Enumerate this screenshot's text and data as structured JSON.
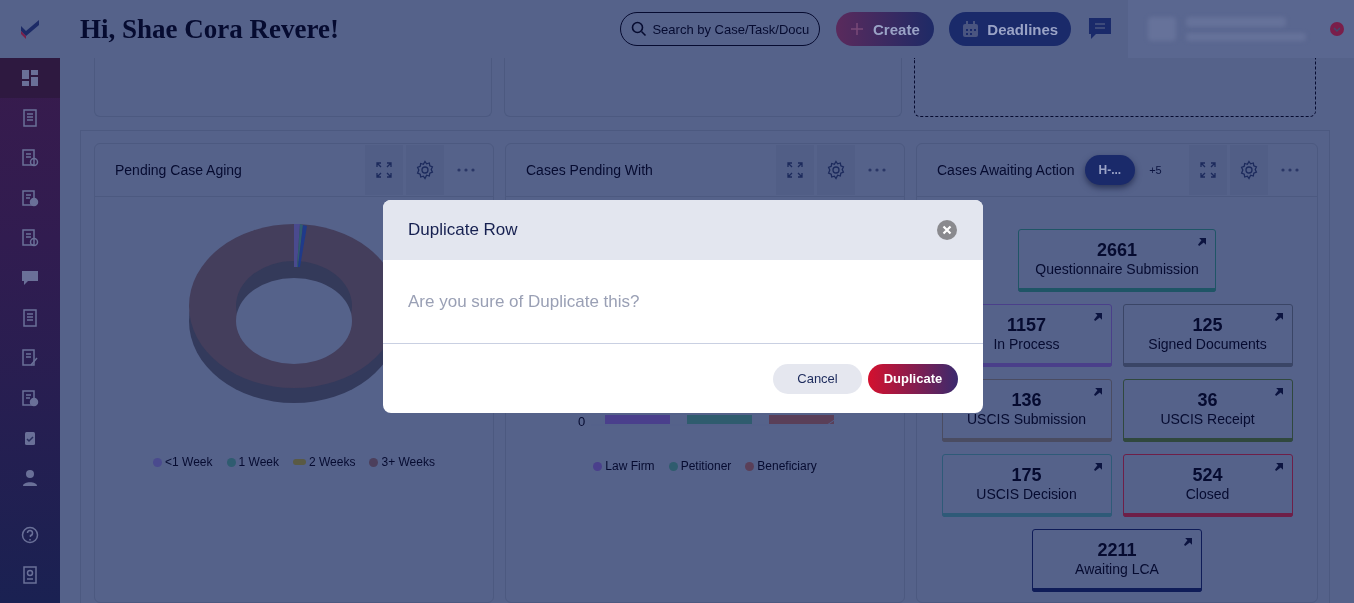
{
  "header": {
    "greeting": "Hi, Shae Cora Revere!",
    "search": {
      "placeholder": "Search by Case/Task/Docu"
    },
    "create_button": "Create",
    "deadlines_button": "Deadlines"
  },
  "sidebar": {
    "items": [
      {
        "kind": "dashboard",
        "selected": true
      },
      {
        "kind": "documents",
        "selected": false
      },
      {
        "kind": "checklist",
        "selected": false
      },
      {
        "kind": "invoice",
        "selected": false
      },
      {
        "kind": "checklist",
        "selected": false
      },
      {
        "kind": "chat",
        "selected": false
      },
      {
        "kind": "documents",
        "selected": false
      },
      {
        "kind": "edit",
        "selected": false
      },
      {
        "kind": "invoice",
        "selected": false
      },
      {
        "kind": "clipboard",
        "selected": false
      },
      {
        "kind": "person",
        "selected": false
      }
    ],
    "bottom_items": [
      {
        "kind": "help",
        "selected": false
      },
      {
        "kind": "book",
        "selected": false
      }
    ]
  },
  "widgets": [
    {
      "kind": "donut",
      "title": "Pending Case Aging",
      "legend": [
        {
          "label": "<1 Week",
          "color": "#4a4a8e"
        },
        {
          "label": "1 Week",
          "color": "#2f5c70"
        },
        {
          "label": "2 Weeks",
          "color": "#5a5a44"
        },
        {
          "label": "3+ Weeks",
          "color": "#4c3f5c"
        }
      ]
    },
    {
      "kind": "bars",
      "title": "Cases Pending With",
      "axis_label": "0",
      "legend": [
        {
          "label": "Law Firm",
          "color": "#4a3f8c"
        },
        {
          "label": "Petitioner",
          "color": "#2f5c6e"
        },
        {
          "label": "Beneficiary",
          "color": "#5a3f58"
        }
      ]
    },
    {
      "kind": "tiles",
      "title": "Cases Awaiting Action",
      "filter_chip": "H-...",
      "more_count": "+5",
      "tile_rows": [
        [
          {
            "value": "2661",
            "label": "Questionnaire Submission",
            "color": "#1f5566"
          }
        ],
        [
          {
            "value": "1157",
            "label": "In Process",
            "color": "#4a3f8a"
          },
          {
            "value": "125",
            "label": "Signed Documents",
            "color": "#3a4566"
          }
        ],
        [
          {
            "value": "136",
            "label": "USCIS Submission",
            "color": "#4a4c62"
          },
          {
            "value": "36",
            "label": "USCIS Receipt",
            "color": "#30483e"
          }
        ],
        [
          {
            "value": "175",
            "label": "USCIS Decision",
            "color": "#2e5a78"
          },
          {
            "value": "524",
            "label": "Closed",
            "color": "#6e1f48"
          }
        ],
        [
          {
            "value": "2211",
            "label": "Awaiting LCA",
            "color": "#0f1c58"
          }
        ]
      ]
    }
  ],
  "dialog": {
    "title": "Duplicate Row",
    "message": "Are you sure of Duplicate this?",
    "buttons": [
      {
        "label": "Cancel",
        "kind": "secondary"
      },
      {
        "label": "Duplicate",
        "kind": "primary"
      }
    ]
  }
}
